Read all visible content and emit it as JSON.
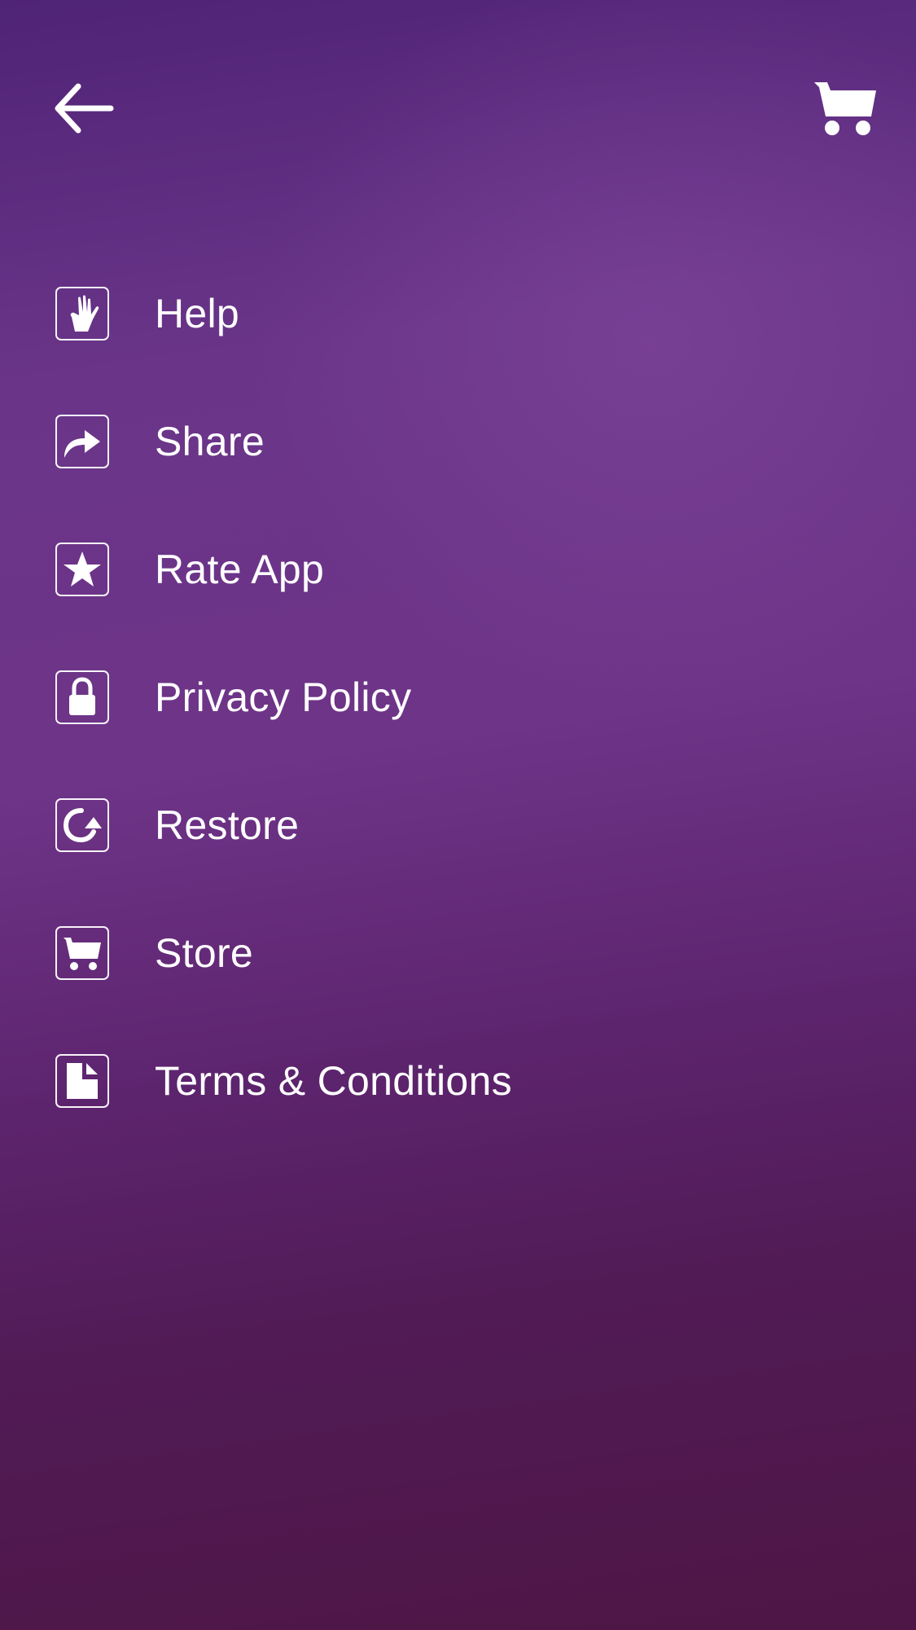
{
  "header": {
    "back_icon": "arrow-left-icon",
    "cart_icon": "shopping-cart-icon"
  },
  "menu": {
    "items": [
      {
        "label": "Help",
        "icon": "hand-icon"
      },
      {
        "label": "Share",
        "icon": "share-arrow-icon"
      },
      {
        "label": "Rate App",
        "icon": "star-icon"
      },
      {
        "label": "Privacy Policy",
        "icon": "lock-icon"
      },
      {
        "label": "Restore",
        "icon": "restore-icon"
      },
      {
        "label": "Store",
        "icon": "cart-icon"
      },
      {
        "label": "Terms & Conditions",
        "icon": "document-icon"
      }
    ]
  },
  "colors": {
    "background_top": "#4f2376",
    "background_mid": "#6e3488",
    "background_bottom": "#4e1645",
    "foreground": "#ffffff"
  }
}
